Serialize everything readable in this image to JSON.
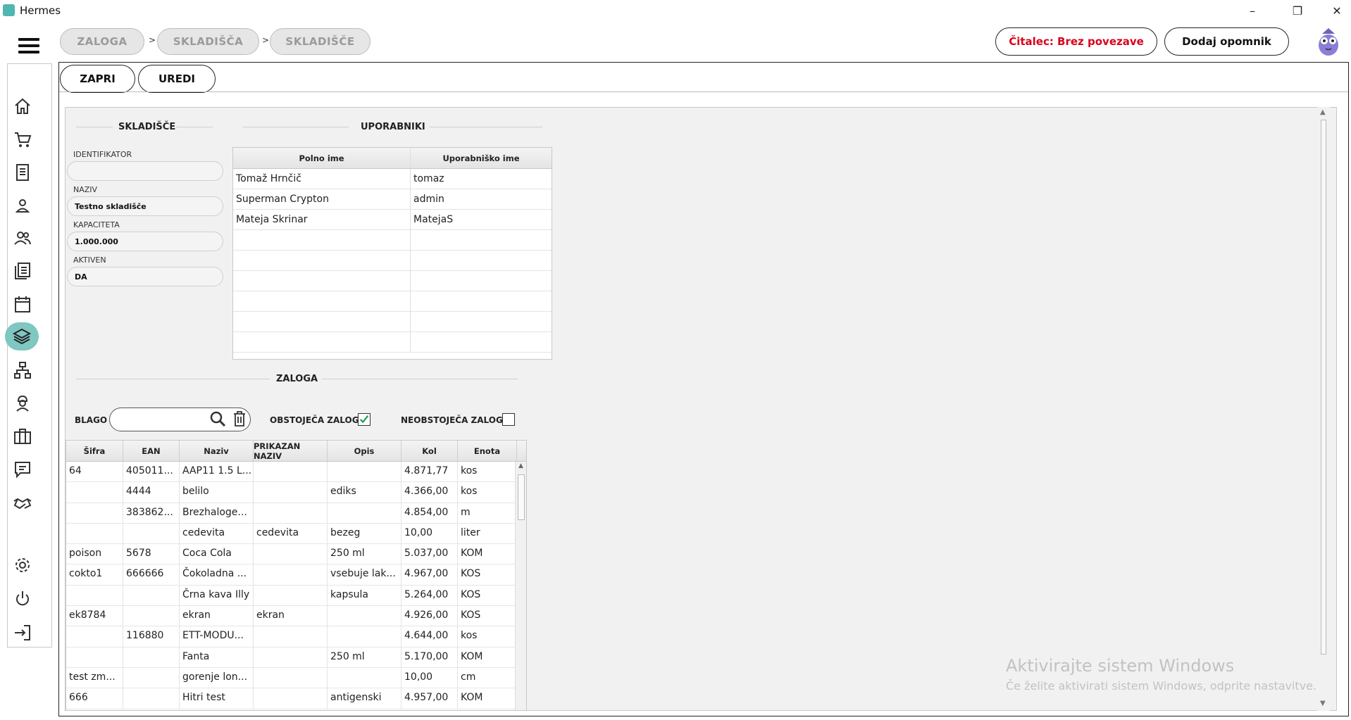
{
  "window": {
    "title": "Hermes",
    "min": "–",
    "max": "❐",
    "close": "✕"
  },
  "breadcrumb": [
    "ZALOGA",
    "SKLADIŠČA",
    "SKLADIŠČE"
  ],
  "breadcrumb_sep": ">",
  "header": {
    "reader_label": "Čitalec: Brez povezave",
    "reminder_label": "Dodaj opomnik"
  },
  "toolbar": {
    "close_label": "ZAPRI",
    "edit_label": "UREDI"
  },
  "warehouse": {
    "title": "SKLADIŠČE",
    "fields": [
      {
        "label": "IDENTIFIKATOR",
        "value": ""
      },
      {
        "label": "NAZIV",
        "value": "Testno skladišče"
      },
      {
        "label": "KAPACITETA",
        "value": "1.000.000"
      },
      {
        "label": "AKTIVEN",
        "value": "DA"
      }
    ]
  },
  "users": {
    "title": "UPORABNIKI",
    "columns": [
      "Polno ime",
      "Uporabniško ime"
    ],
    "rows": [
      [
        "Tomaž Hrnčič",
        "tomaz"
      ],
      [
        "Superman Crypton",
        "admin"
      ],
      [
        "Mateja Skrinar",
        "MatejaS"
      ],
      [
        "",
        ""
      ],
      [
        "",
        ""
      ],
      [
        "",
        ""
      ],
      [
        "",
        ""
      ],
      [
        "",
        ""
      ],
      [
        "",
        ""
      ]
    ]
  },
  "stock": {
    "title": "ZALOGA",
    "filter_label": "BLAGO",
    "filter_value": "",
    "existing_label": "OBSTOJEČA ZALOGA",
    "existing_checked": true,
    "nonexisting_label": "NEOBSTOJEČA ZALOGA",
    "nonexisting_checked": false,
    "columns": [
      "Šifra",
      "EAN",
      "Naziv",
      "PRIKAZAN NAZIV",
      "Opis",
      "Kol",
      "Enota"
    ],
    "rows": [
      [
        "64",
        "405011...",
        "AAP11 1.5 L...",
        "",
        "",
        "4.871,77",
        "kos"
      ],
      [
        "",
        "4444",
        "belilo",
        "",
        "ediks",
        "4.366,00",
        "kos"
      ],
      [
        "",
        "383862...",
        "Brezhaloge...",
        "",
        "",
        "4.854,00",
        "m"
      ],
      [
        "",
        "",
        "cedevita",
        "cedevita",
        "bezeg",
        "10,00",
        "liter"
      ],
      [
        "poison",
        "5678",
        "Coca Cola",
        "",
        "250 ml",
        "5.037,00",
        "KOM"
      ],
      [
        "cokto1",
        "666666",
        "Čokoladna ...",
        "",
        "vsebuje lak...",
        "4.967,00",
        "KOS"
      ],
      [
        "",
        "",
        "Črna kava Illy",
        "",
        "kapsula",
        "5.264,00",
        "KOS"
      ],
      [
        "ek8784",
        "",
        "ekran",
        "ekran",
        "",
        "4.926,00",
        "KOS"
      ],
      [
        "",
        "116880",
        "ETT-MODU...",
        "",
        "",
        "4.644,00",
        "kos"
      ],
      [
        "",
        "",
        "Fanta",
        "",
        "250 ml",
        "5.170,00",
        "KOM"
      ],
      [
        "test zm...",
        "",
        "gorenje lon...",
        "",
        "",
        "10,00",
        "cm"
      ],
      [
        "666",
        "",
        "Hitri test",
        "",
        "antigenski",
        "4.957,00",
        "KOM"
      ]
    ]
  },
  "watermark": {
    "line1": "Aktivirajte sistem Windows",
    "line2": "Če želite aktivirati sistem Windows, odprite nastavitve."
  },
  "colors": {
    "accent": "#7fc7c1",
    "reader_red": "#d8001c",
    "check_green": "#1e9e4a"
  },
  "nav_icons": [
    "home-icon",
    "cart-icon",
    "document-icon",
    "user-icon",
    "users-icon",
    "list-icon",
    "calendar-icon",
    "layers-icon",
    "network-icon",
    "worker-icon",
    "briefcase-icon",
    "chat-icon",
    "handshake-icon",
    "settings-icon",
    "power-icon",
    "logout-icon"
  ]
}
